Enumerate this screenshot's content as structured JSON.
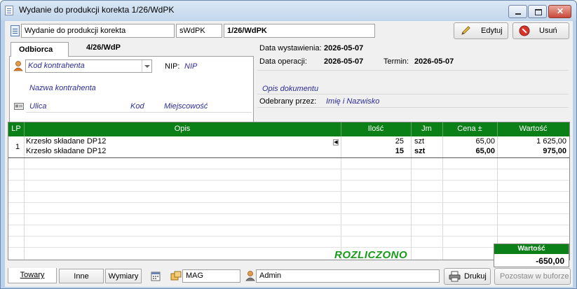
{
  "window": {
    "title": "Wydanie do produkcji korekta 1/26/WdPK"
  },
  "header": {
    "doc_type": "Wydanie do produkcji korekta",
    "series": "sWdPK",
    "number": "1/26/WdPK",
    "edit_label": "Edytuj",
    "delete_label": "Usuń"
  },
  "contractor": {
    "tab_label": "Odbiorca",
    "ref_number": "4/26/WdP",
    "code_placeholder": "Kod kontrahenta",
    "nip_label": "NIP:",
    "nip_value": "NIP",
    "name_placeholder": "Nazwa kontrahenta",
    "street_placeholder": "Ulica",
    "postal_placeholder": "Kod",
    "city_placeholder": "Miejscowość"
  },
  "dates": {
    "issue_label": "Data wystawienia:",
    "issue_value": "2026-05-07",
    "operation_label": "Data operacji:",
    "operation_value": "2026-05-07",
    "due_label": "Termin:",
    "due_value": "2026-05-07",
    "description_placeholder": "Opis dokumentu",
    "received_label": "Odebrany przez:",
    "received_value": "Imię i Nazwisko"
  },
  "grid": {
    "columns": [
      "LP",
      "Opis",
      "Ilość",
      "Jm",
      "Cena ±",
      "Wartość"
    ],
    "rows": [
      {
        "lp": "1",
        "opis": "Krzesło składane DP12",
        "ilosc": "25",
        "jm": "szt",
        "cena": "65,00",
        "wartosc": "1 625,00",
        "bold": false
      },
      {
        "lp": "",
        "opis": "Krzesło składane DP12",
        "ilosc": "15",
        "jm": "szt",
        "cena": "65,00",
        "wartosc": "975,00",
        "bold": true
      }
    ]
  },
  "status": {
    "settled": "ROZLICZONO",
    "total_label": "Wartość",
    "total_value": "-650,00"
  },
  "footer": {
    "tabs": [
      "Towary",
      "Inne",
      "Wymiary"
    ],
    "warehouse": "MAG",
    "user": "Admin",
    "print_label": "Drukuj",
    "buffer_label": "Pozostaw w buforze"
  },
  "colors": {
    "grid_header": "#0a8016",
    "settled_text": "#1a9a1a",
    "placeholder_text": "#2c2c9c"
  }
}
